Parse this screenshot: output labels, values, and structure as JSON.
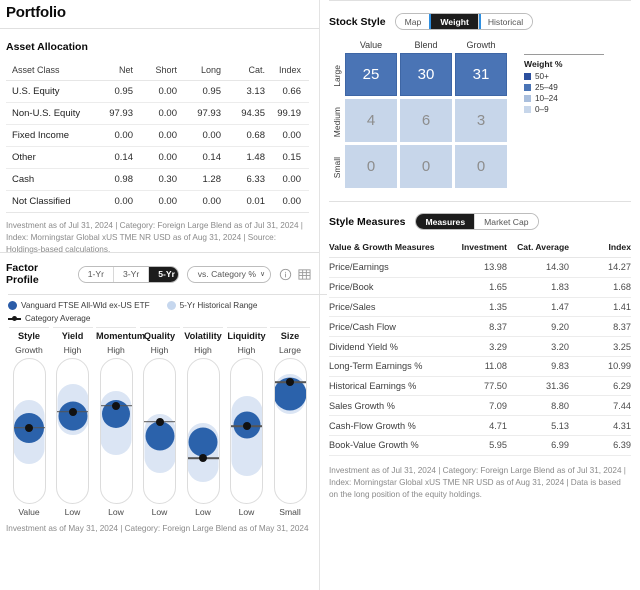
{
  "page": {
    "title": "Portfolio"
  },
  "asset_allocation": {
    "section_title": "Asset Allocation",
    "columns": [
      "Asset Class",
      "Net",
      "Short",
      "Long",
      "Cat.",
      "Index"
    ],
    "rows": [
      {
        "label": "U.S. Equity",
        "net": "0.95",
        "short": "0.00",
        "long": "0.95",
        "cat": "3.13",
        "index": "0.66"
      },
      {
        "label": "Non-U.S. Equity",
        "net": "97.93",
        "short": "0.00",
        "long": "97.93",
        "cat": "94.35",
        "index": "99.19"
      },
      {
        "label": "Fixed Income",
        "net": "0.00",
        "short": "0.00",
        "long": "0.00",
        "cat": "0.68",
        "index": "0.00"
      },
      {
        "label": "Other",
        "net": "0.14",
        "short": "0.00",
        "long": "0.14",
        "cat": "1.48",
        "index": "0.15"
      },
      {
        "label": "Cash",
        "net": "0.98",
        "short": "0.30",
        "long": "1.28",
        "cat": "6.33",
        "index": "0.00"
      },
      {
        "label": "Not Classified",
        "net": "0.00",
        "short": "0.00",
        "long": "0.00",
        "cat": "0.01",
        "index": "0.00"
      }
    ],
    "footnote": "Investment as of Jul 31, 2024 | Category: Foreign Large Blend as of Jul 31, 2024 | Index: Morningstar Global xUS TME NR USD as of Aug 31, 2024 | Source: Holdings-based calculations."
  },
  "stock_style": {
    "section_title": "Stock Style",
    "tabs": [
      {
        "label": "Map",
        "active": false
      },
      {
        "label": "Weight",
        "active": true
      },
      {
        "label": "Historical",
        "active": false
      }
    ],
    "col_headers": [
      "Value",
      "Blend",
      "Growth"
    ],
    "row_headers": [
      "Large",
      "Medium",
      "Small"
    ],
    "grid": [
      [
        {
          "value": "25",
          "tier": "hi"
        },
        {
          "value": "30",
          "tier": "hi"
        },
        {
          "value": "31",
          "tier": "hi"
        }
      ],
      [
        {
          "value": "4",
          "tier": "lo"
        },
        {
          "value": "6",
          "tier": "lo"
        },
        {
          "value": "3",
          "tier": "lo"
        }
      ],
      [
        {
          "value": "0",
          "tier": "lo"
        },
        {
          "value": "0",
          "tier": "lo"
        },
        {
          "value": "0",
          "tier": "lo"
        }
      ]
    ],
    "legend": {
      "title": "Weight %",
      "items": [
        {
          "label": "50+",
          "color": "#2b4f9e"
        },
        {
          "label": "25–49",
          "color": "#4a74b5"
        },
        {
          "label": "10–24",
          "color": "#aabfdd"
        },
        {
          "label": "0–9",
          "color": "#c7d6ea"
        }
      ]
    }
  },
  "style_measures": {
    "section_title": "Style Measures",
    "tabs": [
      {
        "label": "Measures",
        "active": true
      },
      {
        "label": "Market Cap",
        "active": false
      }
    ],
    "columns": [
      "Value & Growth Measures",
      "Investment",
      "Cat. Average",
      "Index"
    ],
    "rows": [
      {
        "label": "Price/Earnings",
        "investment": "13.98",
        "cat": "14.30",
        "index": "14.27"
      },
      {
        "label": "Price/Book",
        "investment": "1.65",
        "cat": "1.83",
        "index": "1.68"
      },
      {
        "label": "Price/Sales",
        "investment": "1.35",
        "cat": "1.47",
        "index": "1.41"
      },
      {
        "label": "Price/Cash Flow",
        "investment": "8.37",
        "cat": "9.20",
        "index": "8.37"
      },
      {
        "label": "Dividend Yield %",
        "investment": "3.29",
        "cat": "3.20",
        "index": "3.25"
      },
      {
        "label": "Long-Term Earnings %",
        "investment": "11.08",
        "cat": "9.83",
        "index": "10.99"
      },
      {
        "label": "Historical Earnings %",
        "investment": "77.50",
        "cat": "31.36",
        "index": "6.29"
      },
      {
        "label": "Sales Growth %",
        "investment": "7.09",
        "cat": "8.80",
        "index": "7.44"
      },
      {
        "label": "Cash-Flow Growth %",
        "investment": "4.71",
        "cat": "5.13",
        "index": "4.31"
      },
      {
        "label": "Book-Value Growth %",
        "investment": "5.95",
        "cat": "6.99",
        "index": "6.39"
      }
    ],
    "footnote": "Investment as of Jul 31, 2024 | Category: Foreign Large Blend as of Jul 31, 2024 | Index: Morningstar Global xUS TME NR USD as of Aug 31, 2024 | Data is based on the long position of the equity holdings."
  },
  "factor_profile": {
    "section_title": "Factor Profile",
    "period_tabs": [
      {
        "label": "1-Yr",
        "active": false
      },
      {
        "label": "3-Yr",
        "active": false
      },
      {
        "label": "5-Yr",
        "active": true
      }
    ],
    "compare_dropdown": {
      "label": "vs. Category %",
      "caret": "∨"
    },
    "icons": [
      "info-icon",
      "table-view-icon"
    ],
    "legend": [
      {
        "name": "Vanguard FTSE All-Wld ex-US ETF",
        "marker": "solid-blue-dot"
      },
      {
        "name": "5-Yr Historical Range",
        "marker": "light-blue-dot"
      },
      {
        "name": "Category Average",
        "marker": "line-with-dot"
      }
    ],
    "footnote": "Investment as of May 31, 2024 | Category: Foreign Large Blend as of May 31, 2024",
    "factors": [
      {
        "name": "Style",
        "top": "Growth",
        "bottom": "Value",
        "investment_pct": 47,
        "bubble_size": 30,
        "range_top_pct": 28,
        "range_bottom_pct": 72,
        "category_avg_pct": 47
      },
      {
        "name": "Yield",
        "top": "High",
        "bottom": "Low",
        "investment_pct": 39,
        "bubble_size": 29,
        "range_top_pct": 17,
        "range_bottom_pct": 52,
        "category_avg_pct": 36
      },
      {
        "name": "Momentum",
        "top": "High",
        "bottom": "Low",
        "investment_pct": 38,
        "bubble_size": 28,
        "range_top_pct": 22,
        "range_bottom_pct": 66,
        "category_avg_pct": 32
      },
      {
        "name": "Quality",
        "top": "High",
        "bottom": "Low",
        "investment_pct": 53,
        "bubble_size": 29,
        "range_top_pct": 38,
        "range_bottom_pct": 78,
        "category_avg_pct": 43
      },
      {
        "name": "Volatility",
        "top": "High",
        "bottom": "Low",
        "investment_pct": 57,
        "bubble_size": 29,
        "range_top_pct": 44,
        "range_bottom_pct": 84,
        "category_avg_pct": 68
      },
      {
        "name": "Liquidity",
        "top": "High",
        "bottom": "Low",
        "investment_pct": 45,
        "bubble_size": 27,
        "range_top_pct": 25,
        "range_bottom_pct": 80,
        "category_avg_pct": 46
      },
      {
        "name": "Size",
        "top": "Large",
        "bottom": "Small",
        "investment_pct": 24,
        "bubble_size": 33,
        "range_top_pct": 10,
        "range_bottom_pct": 38,
        "category_avg_pct": 16
      }
    ]
  }
}
